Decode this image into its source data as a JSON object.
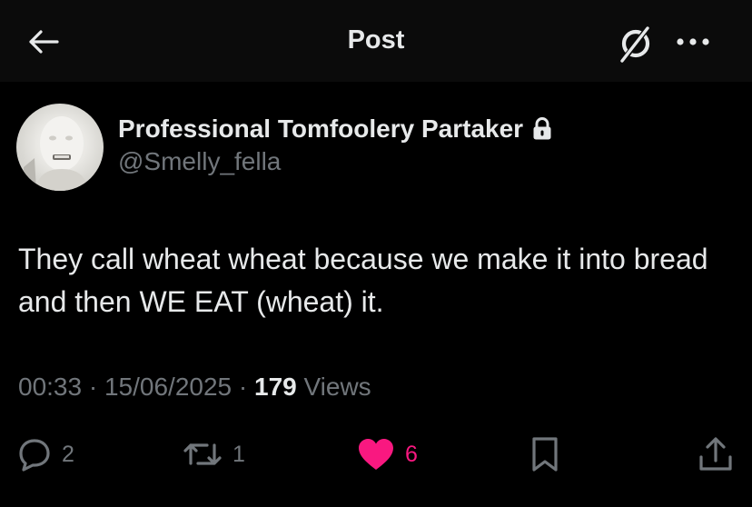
{
  "header": {
    "title": "Post",
    "back_icon": "arrow-left-icon",
    "grok_icon": "grok-icon",
    "more_icon": "more-horizontal-icon"
  },
  "author": {
    "display_name": "Professional Tomfoolery Partaker",
    "handle": "@Smelly_fella",
    "protected_icon": "lock-icon"
  },
  "post": {
    "text": "They call wheat wheat because we make it into bread and then WE EAT (wheat) it.",
    "time": "00:33",
    "date": "15/06/2025",
    "views_count": "179",
    "views_label": "Views",
    "separator": "·"
  },
  "actions": {
    "reply": {
      "icon": "reply-icon",
      "count": "2"
    },
    "repost": {
      "icon": "repost-icon",
      "count": "1"
    },
    "like": {
      "icon": "heart-icon",
      "count": "6",
      "active": true
    },
    "bookmark": {
      "icon": "bookmark-icon"
    },
    "share": {
      "icon": "share-icon"
    }
  },
  "colors": {
    "background": "#000000",
    "header_background": "#0b0b0b",
    "text_primary": "#e7e9ea",
    "text_secondary": "#71767b",
    "like_active": "#f91880"
  }
}
